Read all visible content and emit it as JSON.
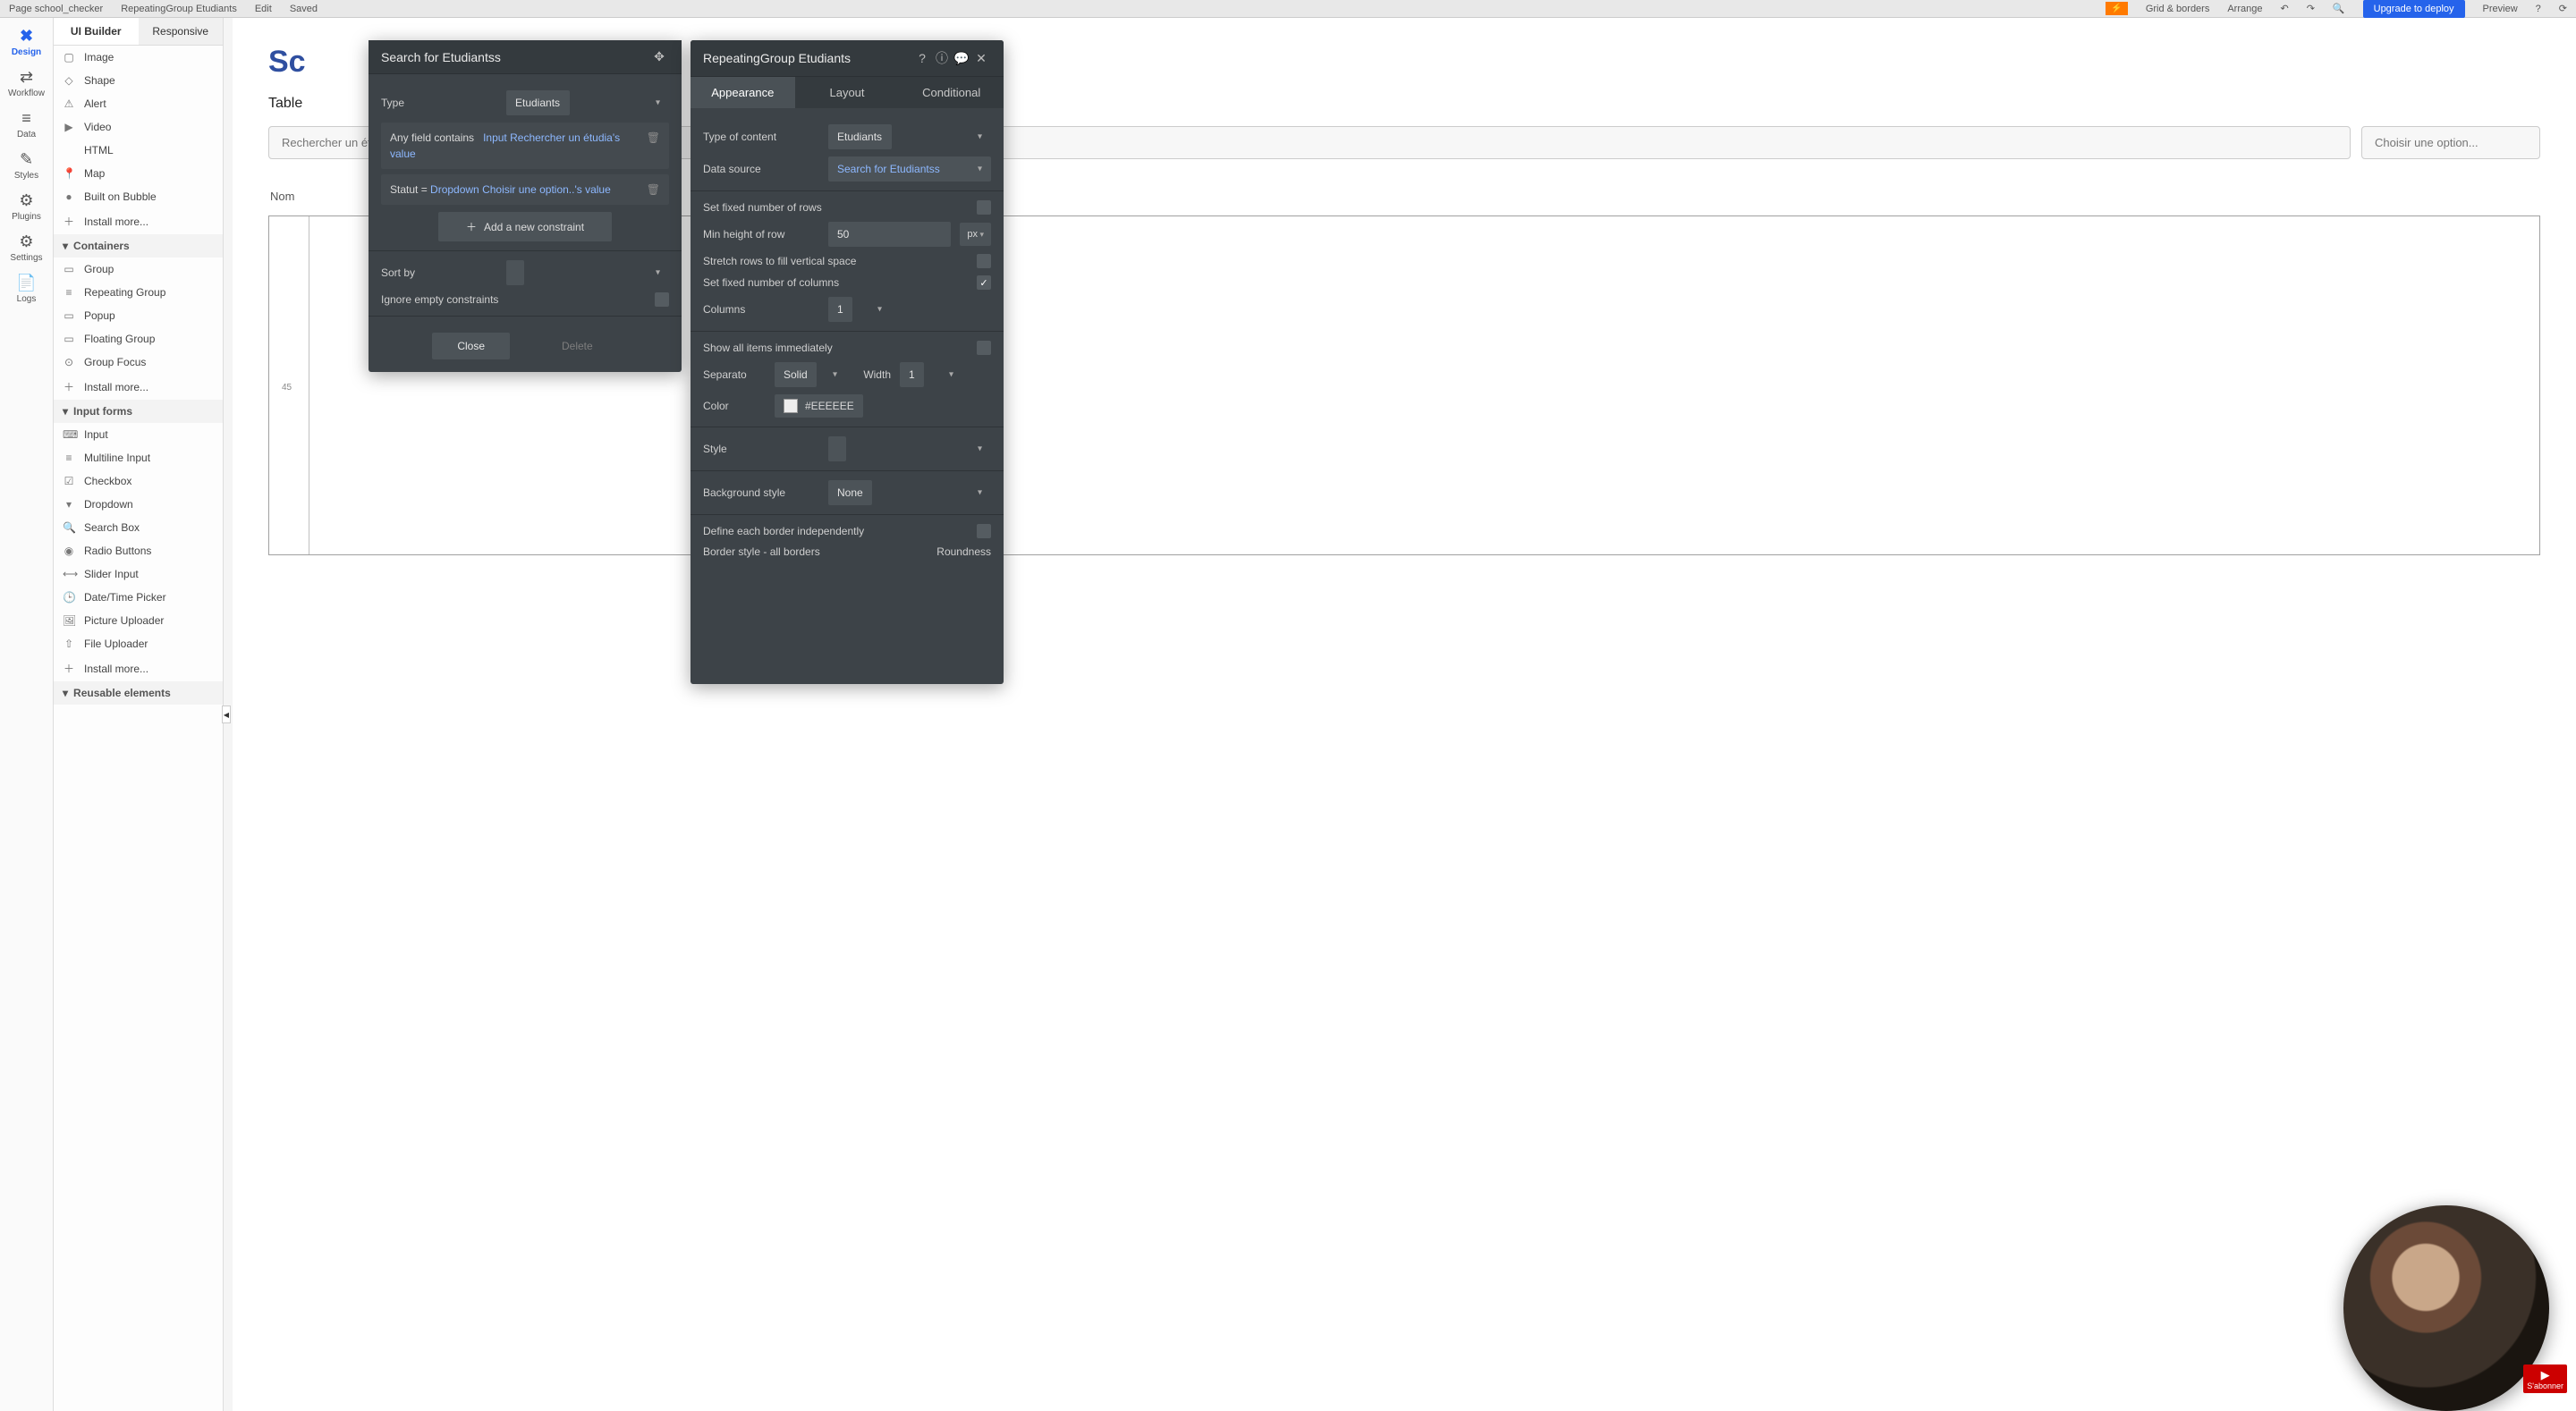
{
  "topbar": {
    "page": "Page school_checker",
    "element": "RepeatingGroup Etudiants",
    "edit": "Edit",
    "saved": "Saved",
    "grid": "Grid & borders",
    "arrange": "Arrange",
    "deploy": "Upgrade to deploy",
    "preview": "Preview"
  },
  "leftrail": [
    {
      "label": "Design",
      "icon": "✖"
    },
    {
      "label": "Workflow",
      "icon": "⇄"
    },
    {
      "label": "Data",
      "icon": "≡"
    },
    {
      "label": "Styles",
      "icon": "✎"
    },
    {
      "label": "Plugins",
      "icon": "⚙"
    },
    {
      "label": "Settings",
      "icon": "⚙"
    },
    {
      "label": "Logs",
      "icon": "📄"
    }
  ],
  "eltabs": {
    "a": "UI Builder",
    "b": "Responsive"
  },
  "elements_visual": [
    {
      "icon": "▢",
      "label": "Image"
    },
    {
      "icon": "◇",
      "label": "Shape"
    },
    {
      "icon": "⚠",
      "label": "Alert"
    },
    {
      "icon": "▶",
      "label": "Video"
    },
    {
      "icon": "</>",
      "label": "HTML"
    },
    {
      "icon": "📍",
      "label": "Map"
    },
    {
      "icon": "●",
      "label": "Built on Bubble"
    },
    {
      "icon": "＋",
      "label": "Install more..."
    }
  ],
  "cat_containers": "Containers",
  "elements_containers": [
    {
      "icon": "▭",
      "label": "Group"
    },
    {
      "icon": "≡",
      "label": "Repeating Group"
    },
    {
      "icon": "▭",
      "label": "Popup"
    },
    {
      "icon": "▭",
      "label": "Floating Group"
    },
    {
      "icon": "⊙",
      "label": "Group Focus"
    },
    {
      "icon": "＋",
      "label": "Install more..."
    }
  ],
  "cat_input": "Input forms",
  "elements_input": [
    {
      "icon": "⌨",
      "label": "Input"
    },
    {
      "icon": "≡",
      "label": "Multiline Input"
    },
    {
      "icon": "☑",
      "label": "Checkbox"
    },
    {
      "icon": "▾",
      "label": "Dropdown"
    },
    {
      "icon": "🔍",
      "label": "Search Box"
    },
    {
      "icon": "◉",
      "label": "Radio Buttons"
    },
    {
      "icon": "⟷",
      "label": "Slider Input"
    },
    {
      "icon": "🕒",
      "label": "Date/Time Picker"
    },
    {
      "icon": "🖼",
      "label": "Picture Uploader"
    },
    {
      "icon": "⇧",
      "label": "File Uploader"
    },
    {
      "icon": "＋",
      "label": "Install more..."
    }
  ],
  "cat_reusable": "Reusable elements",
  "canvas": {
    "title_prefix": "Sc",
    "subtitle": "Table",
    "search_placeholder": "Rechercher un étudiant",
    "dropdown_placeholder": "Choisir une option...",
    "col1": "Nom",
    "rg_badge": "45"
  },
  "search_panel": {
    "title": "Search for Etudiantss",
    "type_label": "Type",
    "type_value": "Etudiants",
    "c1_field": "Any field contains",
    "c1_val": "Input Rechercher un étudia's value",
    "c2_field": "Statut = ",
    "c2_val": "Dropdown Choisir une option..'s value",
    "add": "Add a new constraint",
    "sort_label": "Sort by",
    "ignore_label": "Ignore empty constraints",
    "close": "Close",
    "delete": "Delete"
  },
  "inspector": {
    "title": "RepeatingGroup Etudiants",
    "tab_appearance": "Appearance",
    "tab_layout": "Layout",
    "tab_conditional": "Conditional",
    "type_label": "Type of content",
    "type_value": "Etudiants",
    "ds_label": "Data source",
    "ds_value": "Search for Etudiantss",
    "fixed_rows_label": "Set fixed number of rows",
    "min_h_label": "Min height of row",
    "min_h_value": "50",
    "min_h_unit": "px",
    "stretch_label": "Stretch rows to fill vertical space",
    "fixed_cols_label": "Set fixed number of columns",
    "cols_label": "Columns",
    "cols_value": "1",
    "show_all_label": "Show all items immediately",
    "sep_label": "Separato",
    "sep_value": "Solid",
    "width_label": "Width",
    "width_value": "1",
    "color_label": "Color",
    "color_value": "#EEEEEE",
    "style_label": "Style",
    "bg_label": "Background style",
    "bg_value": "None",
    "border_indep_label": "Define each border independently",
    "border_all_label": "Border style - all borders",
    "roundness_label": "Roundness"
  },
  "subscribe": "S'abonner"
}
